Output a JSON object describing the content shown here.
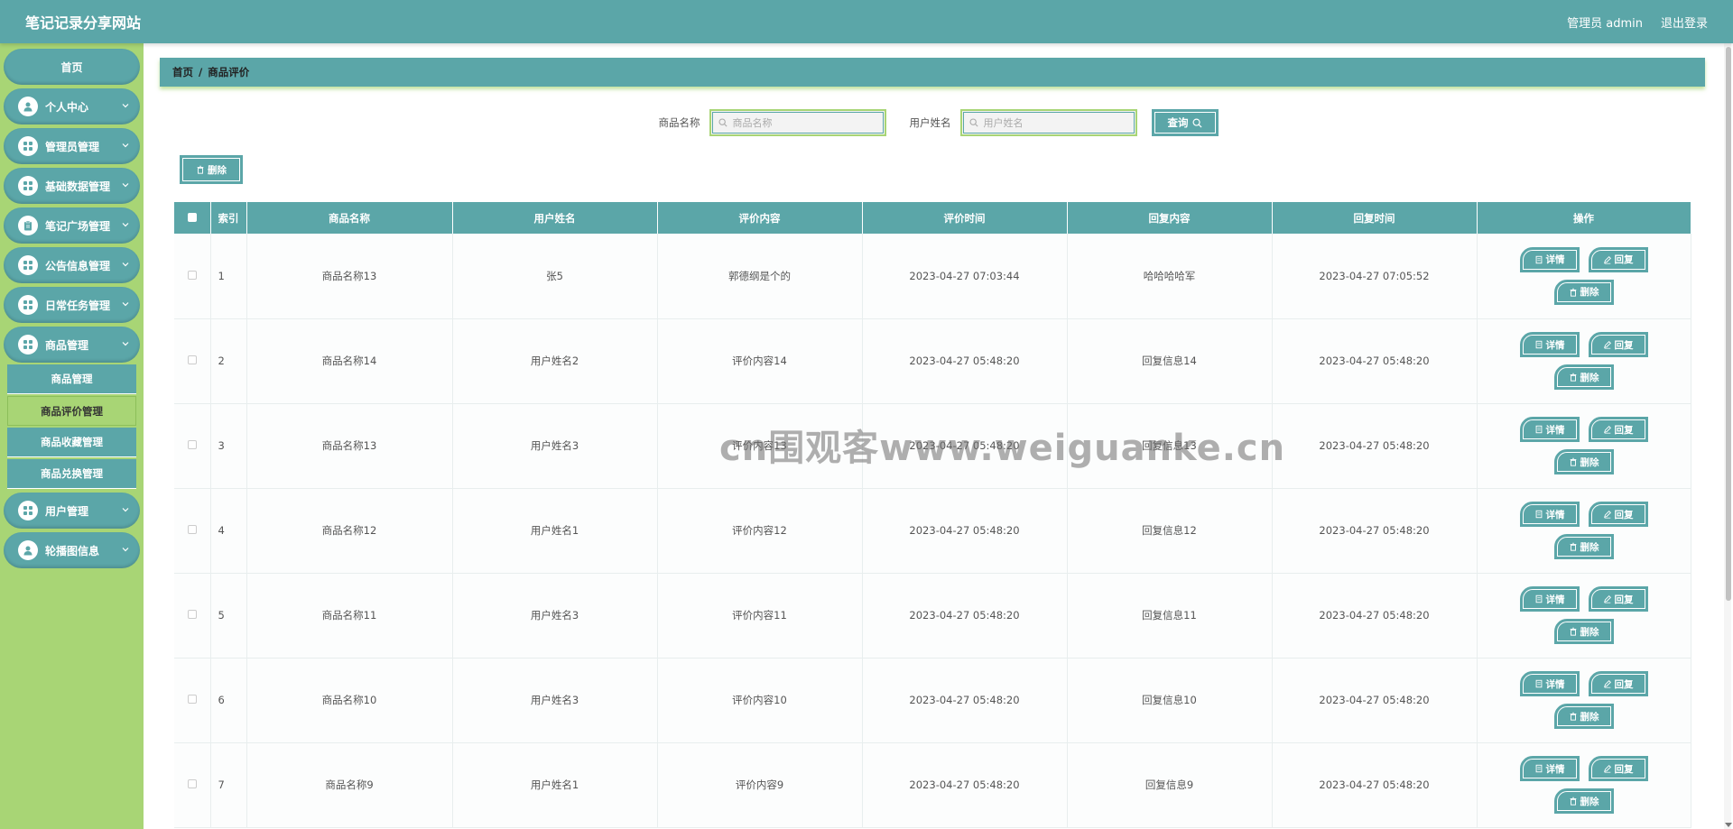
{
  "app": {
    "title": "笔记记录分享网站"
  },
  "header": {
    "admin_label": "管理员 admin",
    "logout_label": "退出登录"
  },
  "sidebar": {
    "home": "首页",
    "items": [
      {
        "label": "个人中心",
        "icon": "user-icon"
      },
      {
        "label": "管理员管理",
        "icon": "grid-icon"
      },
      {
        "label": "基础数据管理",
        "icon": "grid-icon"
      },
      {
        "label": "笔记广场管理",
        "icon": "clipboard-icon"
      },
      {
        "label": "公告信息管理",
        "icon": "grid-icon"
      },
      {
        "label": "日常任务管理",
        "icon": "grid-icon"
      },
      {
        "label": "商品管理",
        "icon": "grid-icon"
      }
    ],
    "submenu": [
      "商品管理",
      "商品评价管理",
      "商品收藏管理",
      "商品兑换管理"
    ],
    "items_after": [
      {
        "label": "用户管理",
        "icon": "grid-icon"
      },
      {
        "label": "轮播图信息",
        "icon": "user-icon"
      }
    ]
  },
  "breadcrumb": {
    "home": "首页",
    "sep": "/",
    "current": "商品评价"
  },
  "search": {
    "name_label": "商品名称",
    "name_placeholder": "商品名称",
    "user_label": "用户姓名",
    "user_placeholder": "用户姓名",
    "query_label": "查询"
  },
  "toolbar": {
    "delete_label": "删除"
  },
  "table": {
    "headers": [
      "索引",
      "商品名称",
      "用户姓名",
      "评价内容",
      "评价时间",
      "回复内容",
      "回复时间",
      "操作"
    ],
    "ops": {
      "detail": "详情",
      "reply": "回复",
      "delete": "删除"
    },
    "rows": [
      [
        "1",
        "商品名称13",
        "张5",
        "郭德纲是个的",
        "2023-04-27 07:03:44",
        "哈哈哈哈军",
        "2023-04-27 07:05:52"
      ],
      [
        "2",
        "商品名称14",
        "用户姓名2",
        "评价内容14",
        "2023-04-27 05:48:20",
        "回复信息14",
        "2023-04-27 05:48:20"
      ],
      [
        "3",
        "商品名称13",
        "用户姓名3",
        "评价内容13",
        "2023-04-27 05:48:20",
        "回复信息13",
        "2023-04-27 05:48:20"
      ],
      [
        "4",
        "商品名称12",
        "用户姓名1",
        "评价内容12",
        "2023-04-27 05:48:20",
        "回复信息12",
        "2023-04-27 05:48:20"
      ],
      [
        "5",
        "商品名称11",
        "用户姓名3",
        "评价内容11",
        "2023-04-27 05:48:20",
        "回复信息11",
        "2023-04-27 05:48:20"
      ],
      [
        "6",
        "商品名称10",
        "用户姓名3",
        "评价内容10",
        "2023-04-27 05:48:20",
        "回复信息10",
        "2023-04-27 05:48:20"
      ],
      [
        "7",
        "商品名称9",
        "用户姓名1",
        "评价内容9",
        "2023-04-27 05:48:20",
        "回复信息9",
        "2023-04-27 05:48:20"
      ]
    ]
  },
  "watermark": "cn围观客www.weiguanke.cn",
  "colors": {
    "primary": "#5ba6a8",
    "accent": "#a8d575",
    "text": "#333333"
  }
}
